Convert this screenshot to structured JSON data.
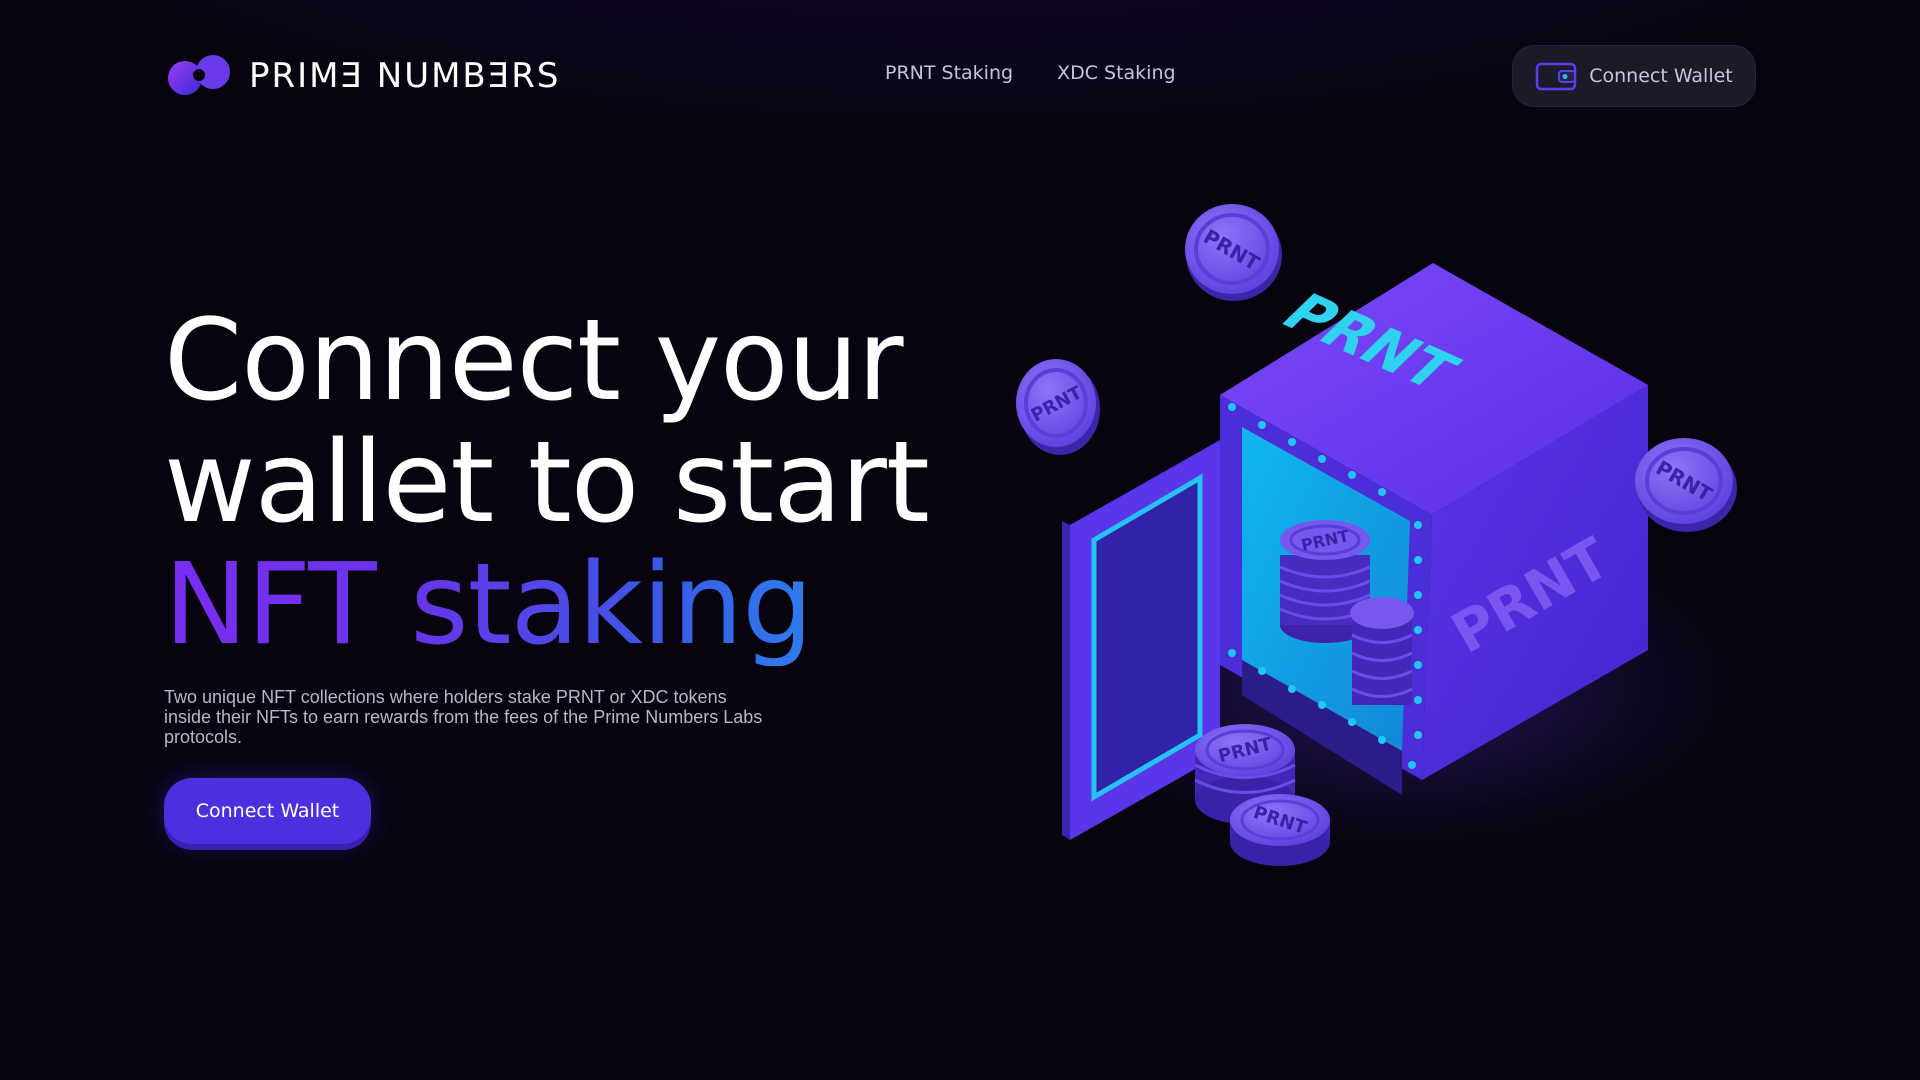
{
  "brand": {
    "name": "PRIME NUMBƎRS",
    "display": "PRIMƎ NUMBƎRS"
  },
  "nav": {
    "items": [
      "PRNT Staking",
      "XDC Staking"
    ]
  },
  "header": {
    "connect_label": "Connect Wallet"
  },
  "hero": {
    "line1": "Connect your",
    "line2": "wallet to start",
    "line3": "NFT staking",
    "description": "Two unique NFT collections where holders stake PRNT or XDC tokens inside their NFTs to earn rewards from the fees of the Prime Numbers Labs protocols.",
    "cta_label": "Connect Wallet"
  },
  "illustration": {
    "vault_label": "PRNT",
    "coin_label": "PRNT",
    "icons": [
      "vault-illustration",
      "prnt-coin-icon"
    ]
  },
  "colors": {
    "background": "#07040f",
    "accent": "#4d2fe0",
    "gradient_start": "#7a2df0",
    "gradient_end": "#1aa6f5",
    "vault": "#5a30e8",
    "vault_interior": "#1fc4f2",
    "coin": "#7b5cf0"
  }
}
